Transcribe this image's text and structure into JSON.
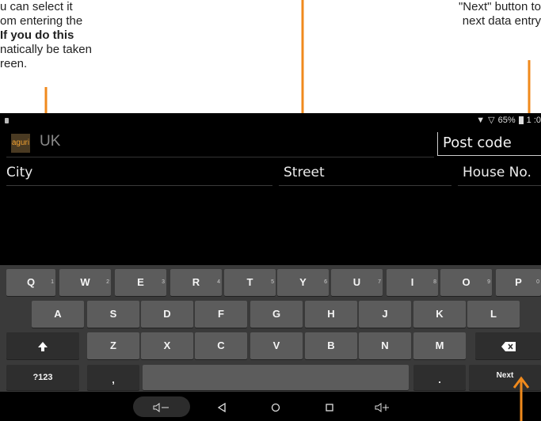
{
  "annotations": {
    "left_lines": [
      "u can select it",
      "om entering the",
      "If you do this",
      "natically be taken",
      "reen."
    ],
    "right_lines": [
      "\"Next\" button to",
      "next data entry"
    ]
  },
  "status_bar": {
    "battery": "65%",
    "time_partial": "1  :0"
  },
  "address_bar": {
    "logo_text": "aguri",
    "country": "UK",
    "postcode_placeholder": "Post code"
  },
  "fields": {
    "city": "City",
    "street": "Street",
    "house_no": "House No."
  },
  "keyboard": {
    "row1": [
      {
        "label": "Q",
        "sup": "1"
      },
      {
        "label": "W",
        "sup": "2"
      },
      {
        "label": "E",
        "sup": "3"
      },
      {
        "label": "R",
        "sup": "4"
      },
      {
        "label": "T",
        "sup": "5"
      },
      {
        "label": "Y",
        "sup": "6"
      },
      {
        "label": "U",
        "sup": "7"
      },
      {
        "label": "I",
        "sup": "8"
      },
      {
        "label": "O",
        "sup": "9"
      },
      {
        "label": "P",
        "sup": "0"
      }
    ],
    "row2": [
      "A",
      "S",
      "D",
      "F",
      "G",
      "H",
      "J",
      "K",
      "L"
    ],
    "row3": [
      "Z",
      "X",
      "C",
      "V",
      "B",
      "N",
      "M"
    ],
    "symbols_label": "?123",
    "comma_label": ",",
    "period_label": ".",
    "next_label": "Next"
  },
  "icons": {
    "shift": "shift-icon",
    "backspace": "backspace-icon",
    "location": "location-icon",
    "wifi": "wifi-icon",
    "battery": "battery-icon"
  },
  "colors": {
    "accent_arrow": "#f08a1c",
    "keyboard_bg": "#3a3a3a",
    "key_bg": "#5c5c5c"
  }
}
